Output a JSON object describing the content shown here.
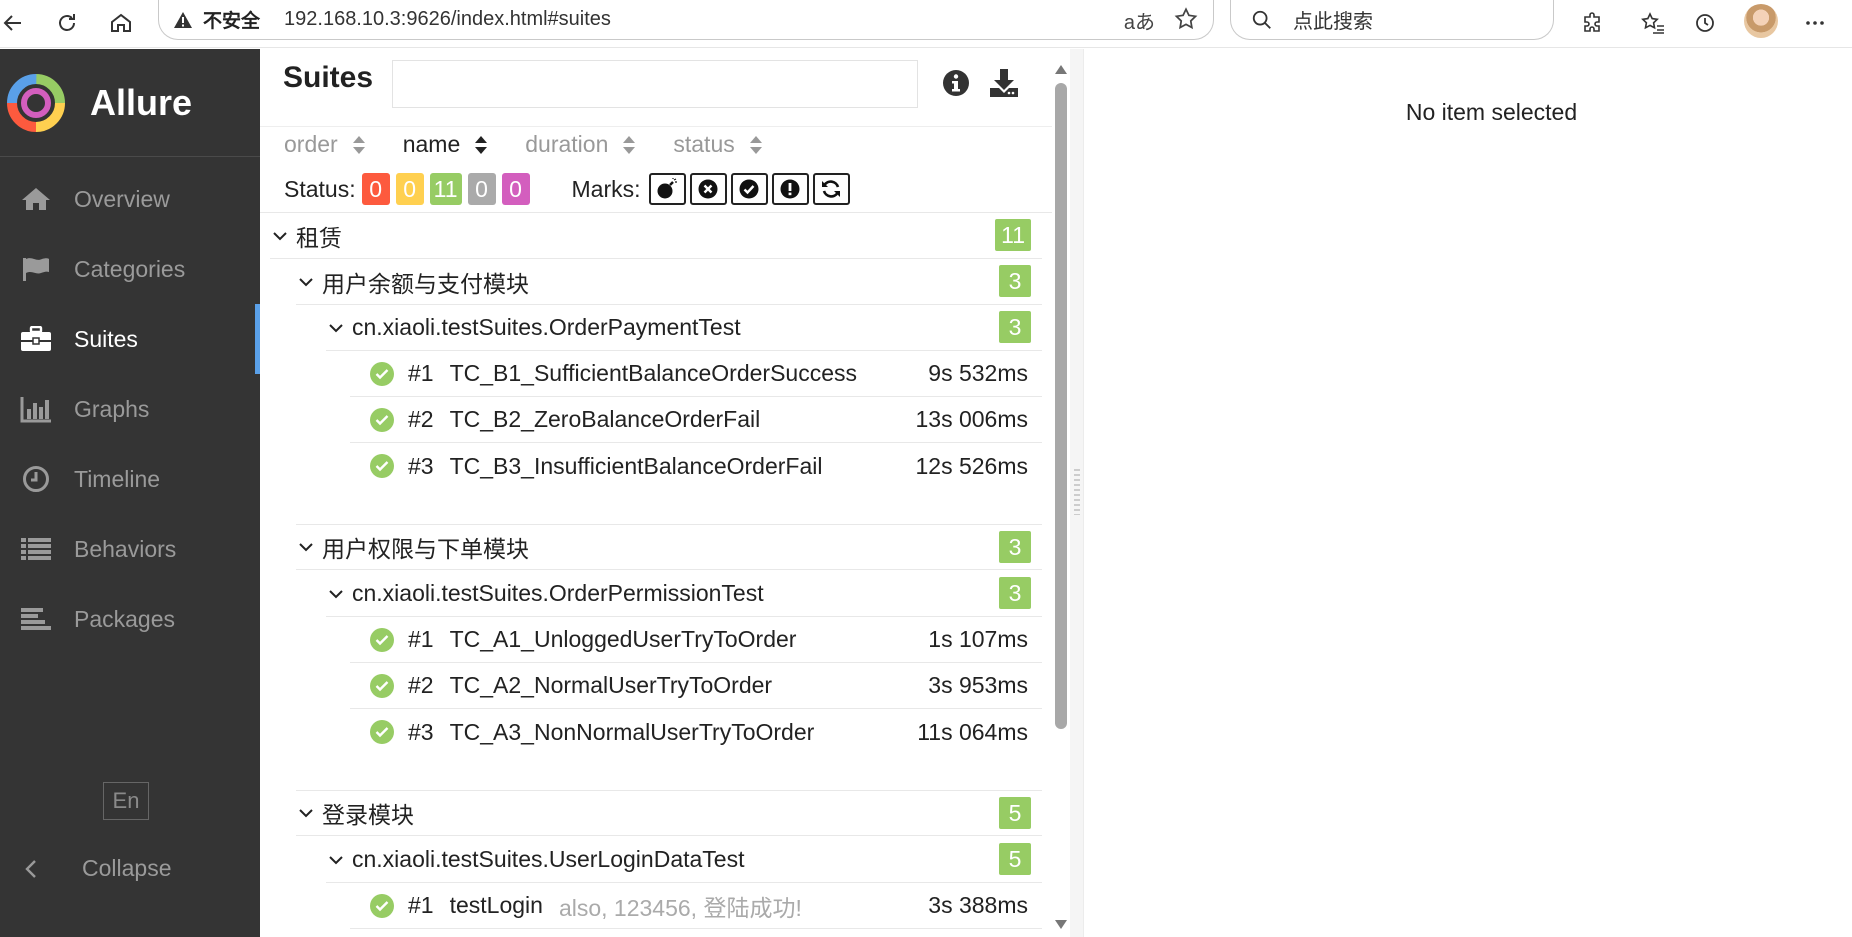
{
  "browser": {
    "security_label": "不安全",
    "url": "192.168.10.3:9626/index.html#suites",
    "search_placeholder": "点此搜索"
  },
  "sidebar": {
    "brand": "Allure",
    "items": [
      {
        "label": "Overview",
        "icon": "home-icon"
      },
      {
        "label": "Categories",
        "icon": "flag-icon"
      },
      {
        "label": "Suites",
        "icon": "briefcase-icon"
      },
      {
        "label": "Graphs",
        "icon": "bar-chart-icon"
      },
      {
        "label": "Timeline",
        "icon": "clock-icon"
      },
      {
        "label": "Behaviors",
        "icon": "list-icon"
      },
      {
        "label": "Packages",
        "icon": "align-left-icon"
      }
    ],
    "active": "Suites",
    "language": "En",
    "collapse": "Collapse"
  },
  "pane": {
    "title": "Suites",
    "sort": {
      "order": "order",
      "name": "name",
      "duration": "duration",
      "status": "status",
      "active": "name"
    },
    "status_label": "Status:",
    "status_counts": {
      "failed": "0",
      "broken": "0",
      "passed": "11",
      "skipped": "0",
      "unknown": "0"
    },
    "marks_label": "Marks:"
  },
  "tree": {
    "root": {
      "label": "租赁",
      "count": "11"
    },
    "groups": [
      {
        "label": "用户余额与支付模块",
        "count": "3",
        "suite": {
          "label": "cn.xiaoli.testSuites.OrderPaymentTest",
          "count": "3"
        },
        "tests": [
          {
            "num": "#1",
            "name": "TC_B1_SufficientBalanceOrderSuccess",
            "params": "",
            "duration": "9s 532ms"
          },
          {
            "num": "#2",
            "name": "TC_B2_ZeroBalanceOrderFail",
            "params": "",
            "duration": "13s 006ms"
          },
          {
            "num": "#3",
            "name": "TC_B3_InsufficientBalanceOrderFail",
            "params": "",
            "duration": "12s 526ms"
          }
        ]
      },
      {
        "label": "用户权限与下单模块",
        "count": "3",
        "suite": {
          "label": "cn.xiaoli.testSuites.OrderPermissionTest",
          "count": "3"
        },
        "tests": [
          {
            "num": "#1",
            "name": "TC_A1_UnloggedUserTryToOrder",
            "params": "",
            "duration": "1s 107ms"
          },
          {
            "num": "#2",
            "name": "TC_A2_NormalUserTryToOrder",
            "params": "",
            "duration": "3s 953ms"
          },
          {
            "num": "#3",
            "name": "TC_A3_NonNormalUserTryToOrder",
            "params": "",
            "duration": "11s 064ms"
          }
        ]
      },
      {
        "label": "登录模块",
        "count": "5",
        "suite": {
          "label": "cn.xiaoli.testSuites.UserLoginDataTest",
          "count": "5"
        },
        "tests": [
          {
            "num": "#1",
            "name": "testLogin",
            "params": "also, 123456, 登陆成功!",
            "duration": "3s 388ms"
          }
        ]
      }
    ]
  },
  "detail": {
    "empty_text": "No item selected"
  },
  "colors": {
    "sidebar_bg": "#343434",
    "passed": "#97cc64",
    "failed": "#fd5a3e",
    "broken": "#ffd050",
    "skipped": "#aaaaaa",
    "unknown": "#d35ebe",
    "active_accent": "#5aa0e8"
  }
}
